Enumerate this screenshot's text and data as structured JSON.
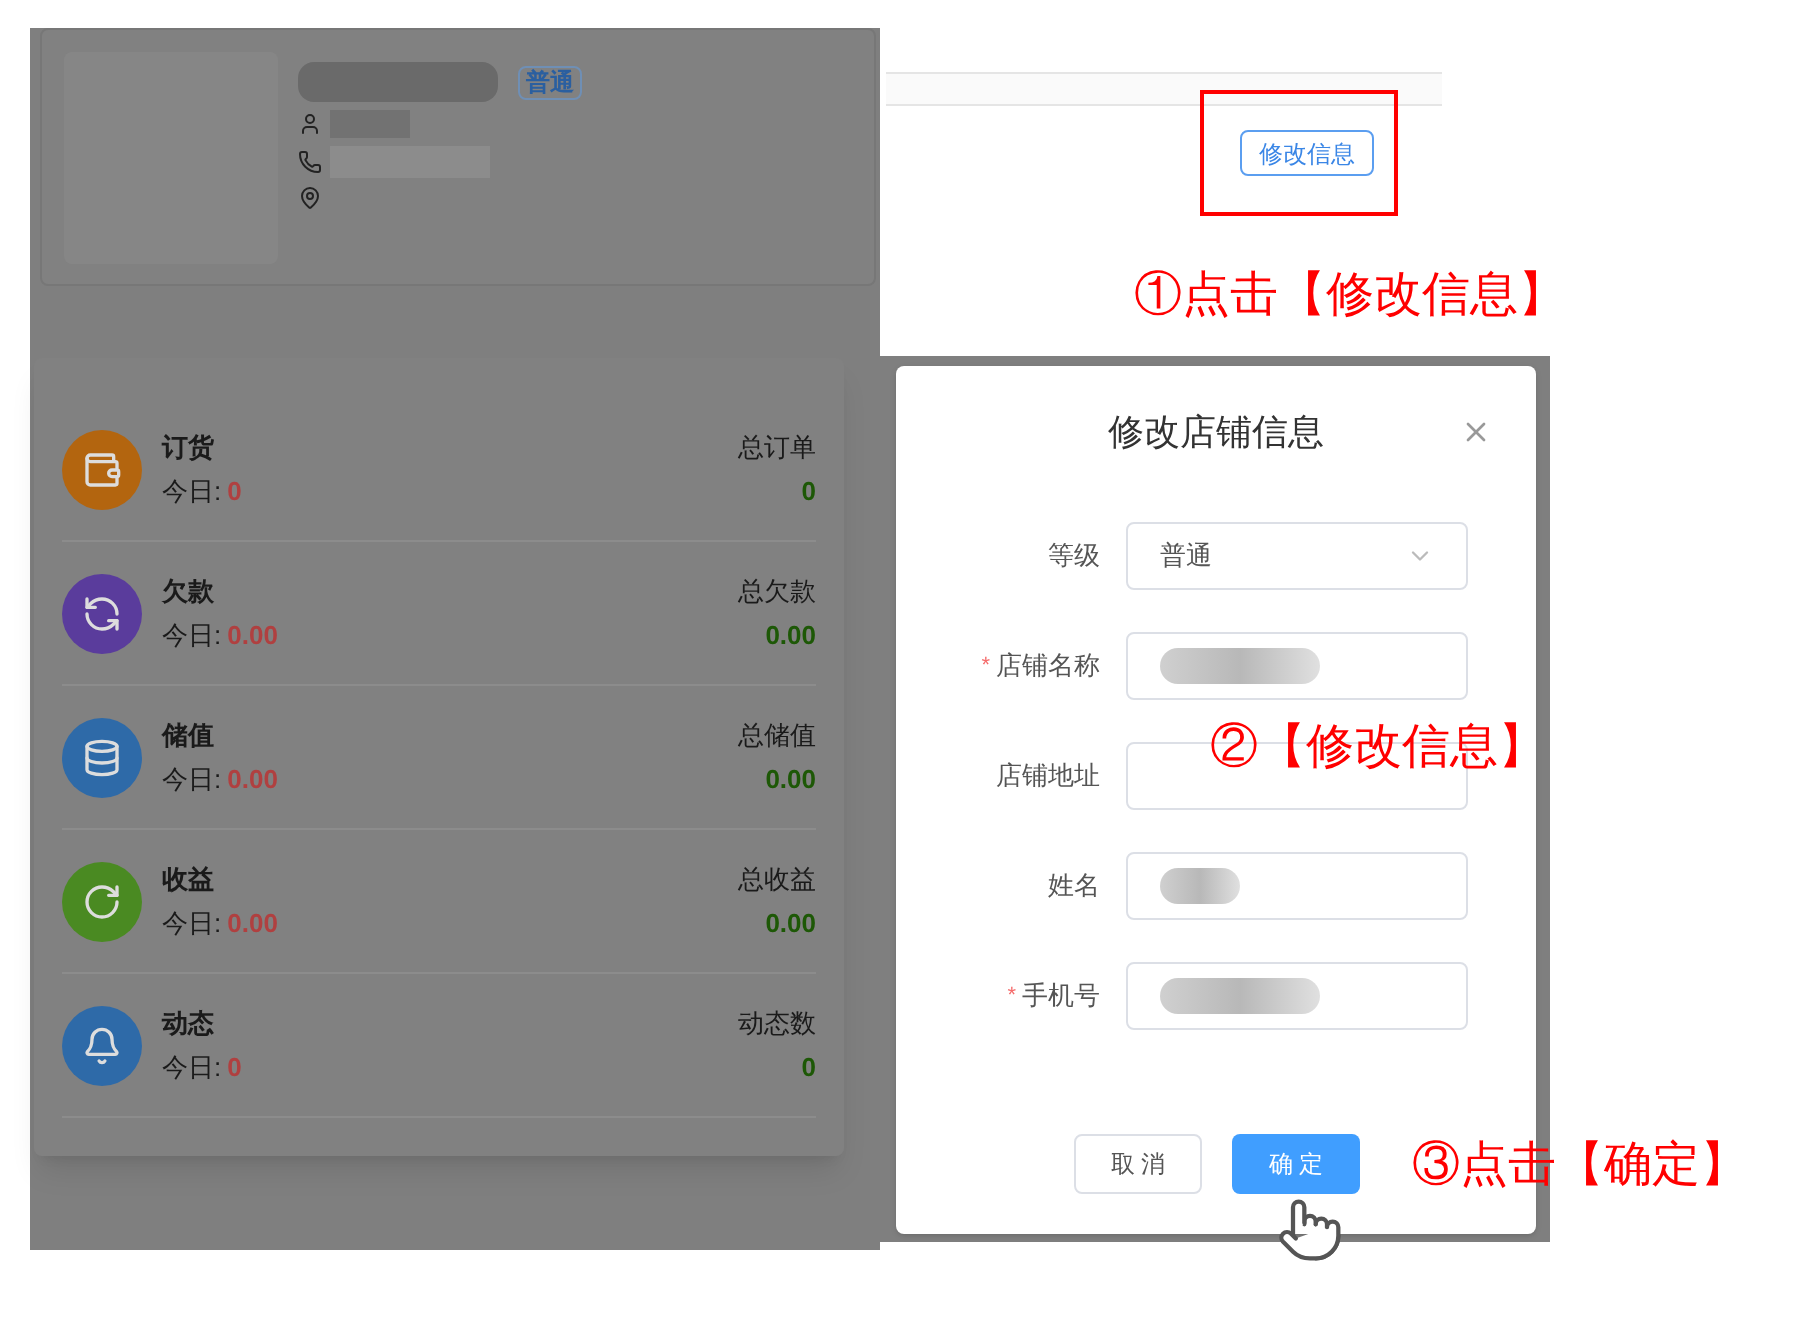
{
  "profile": {
    "badge": "普通"
  },
  "edit_button": "修改信息",
  "stats": [
    {
      "kind": "order",
      "title": "订货",
      "today_label": "今日:",
      "today_value": "0",
      "total_label": "总订单",
      "total_value": "0",
      "color": "#b3650f"
    },
    {
      "kind": "debt",
      "title": "欠款",
      "today_label": "今日:",
      "today_value": "0.00",
      "total_label": "总欠款",
      "total_value": "0.00",
      "color": "#5a3c9c"
    },
    {
      "kind": "storage",
      "title": "储值",
      "today_label": "今日:",
      "today_value": "0.00",
      "total_label": "总储值",
      "total_value": "0.00",
      "color": "#2e6aa8"
    },
    {
      "kind": "income",
      "title": "收益",
      "today_label": "今日:",
      "today_value": "0.00",
      "total_label": "总收益",
      "total_value": "0.00",
      "color": "#4a8a22"
    },
    {
      "kind": "activity",
      "title": "动态",
      "today_label": "今日:",
      "today_value": "0",
      "total_label": "动态数",
      "total_value": "0",
      "color": "#2e6aa8"
    }
  ],
  "dialog": {
    "title": "修改店铺信息",
    "required_mark": "*",
    "fields": [
      {
        "kind": "select",
        "label": "等级",
        "required": false,
        "value": "普通"
      },
      {
        "kind": "redacted",
        "label": "店铺名称",
        "required": true
      },
      {
        "kind": "empty",
        "label": "店铺地址",
        "required": false
      },
      {
        "kind": "redacted",
        "label": "姓名",
        "required": false
      },
      {
        "kind": "redacted",
        "label": "手机号",
        "required": true
      }
    ],
    "buttons": [
      {
        "kind": "default",
        "label": "取 消"
      },
      {
        "kind": "primary",
        "label": "确 定"
      }
    ]
  },
  "annotations": [
    "①点击【修改信息】",
    "②【修改信息】",
    "③点击【确定】"
  ]
}
